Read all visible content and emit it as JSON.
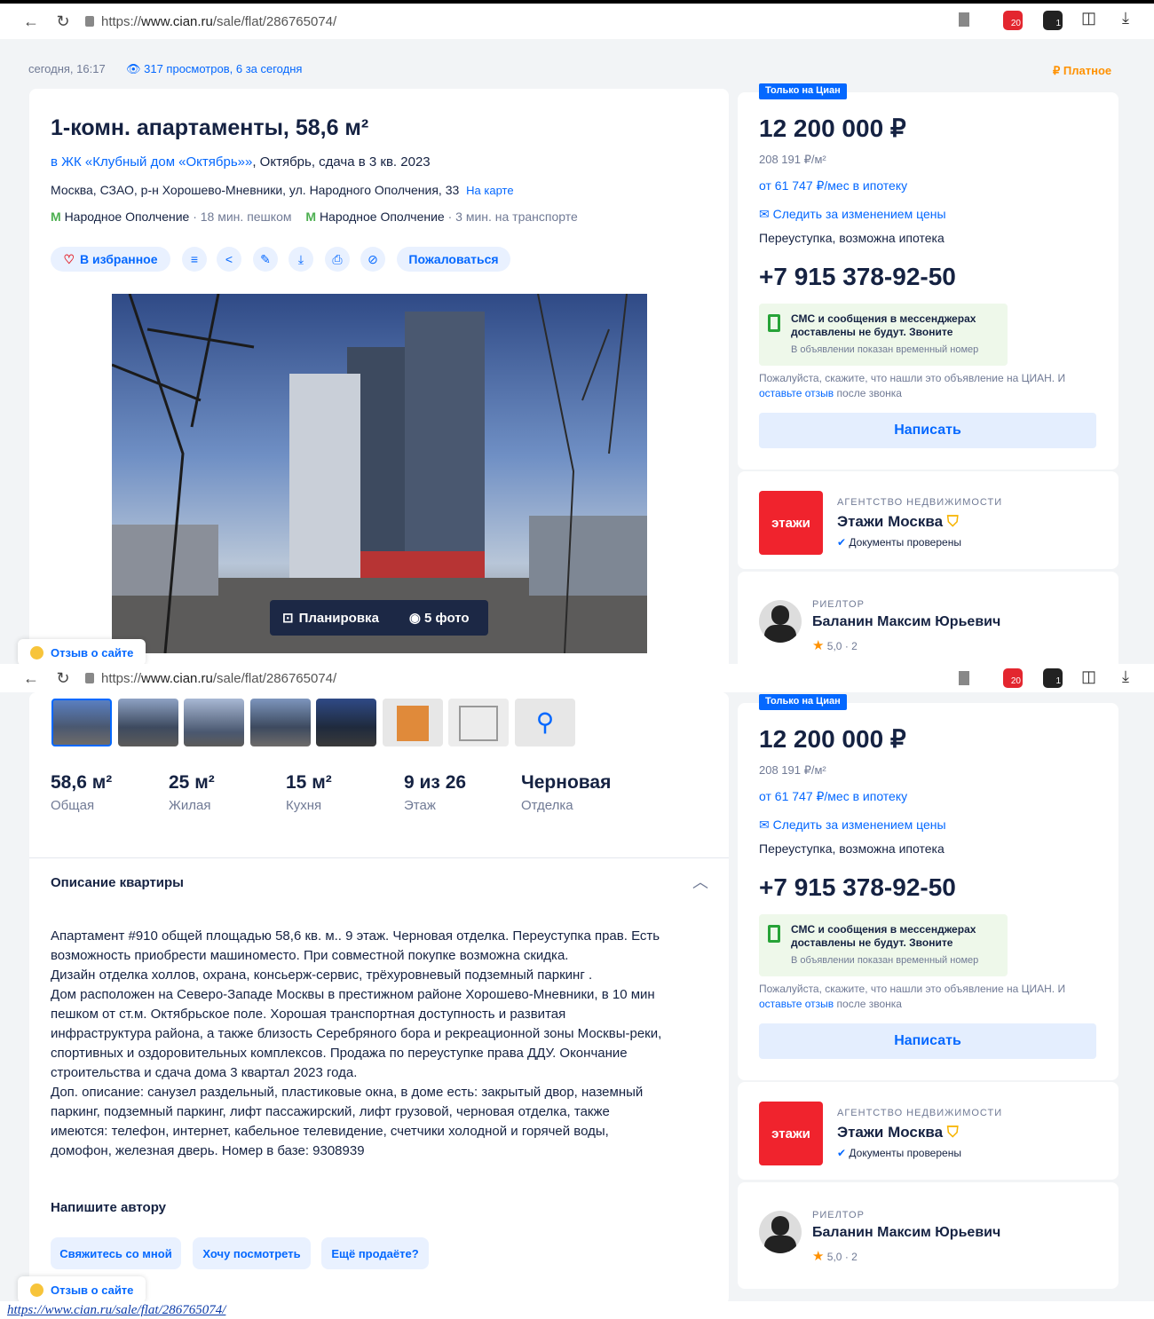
{
  "browser": {
    "url_prefix": "https://",
    "url_host": "www.cian.ru",
    "url_path": "/sale/flat/286765074/",
    "ext1_badge": "20",
    "ext2_badge": "1"
  },
  "meta": {
    "date": "сегодня, 16:17",
    "views": "317 просмотров, 6 за сегодня",
    "paid": "Платное"
  },
  "listing": {
    "title": "1-комн. апартаменты, 58,6 м²",
    "complex_link": "в ЖК «Клубный дом «Октябрь»»",
    "complex_rest": ", Октябрь, сдача в 3 кв. 2023",
    "address": "Москва, СЗАО, р-н Хорошево-Мневники, ул. Народного Ополчения, 33",
    "map_link": "На карте",
    "metro1_name": "Народное Ополчение",
    "metro1_time": "· 18 мин. пешком",
    "metro2_name": "Народное Ополчение",
    "metro2_time": "· 3 мин. на транспорте",
    "favorite": "В избранное",
    "complain": "Пожаловаться",
    "plan_btn": "Планировка",
    "photos_btn": "5 фото"
  },
  "stats": [
    {
      "value": "58,6 м²",
      "label": "Общая"
    },
    {
      "value": "25 м²",
      "label": "Жилая"
    },
    {
      "value": "15 м²",
      "label": "Кухня"
    },
    {
      "value": "9 из 26",
      "label": "Этаж"
    },
    {
      "value": "Черновая",
      "label": "Отделка"
    }
  ],
  "description": {
    "heading": "Описание квартиры",
    "text": "Апартамент #910 общей площадью 58,6 кв. м.. 9 этаж. Черновая отделка. Переуступка прав. Есть\nвозможность приобрести машиноместо. При совместной покупке возможна скидка.\nДизайн отделка холлов, охрана, консьерж-сервис, трёхуровневый подземный паркинг .\nДом расположен на Северо-Западе Москвы в престижном районе Хорошево-Мневники, в 10 мин\nпешком от ст.м. Октябрьское поле. Хорошая транспортная доступность и развитая\nинфраструктура района, а также близость Серебряного бора и рекреационной зоны Москвы-реки,\nспортивных и оздоровительных комплексов. Продажа по переуступке права ДДУ. Окончание\nстроительства и сдача дома 3 квартал 2023 года.\n Доп. описание: санузел раздельный, пластиковые окна, в доме есть: закрытый двор, наземный\nпаркинг, подземный паркинг, лифт пассажирский, лифт грузовой, черновая отделка, также\nимеются: телефон, интернет, кабельное телевидение, счетчики холодной и горячей воды,\nдомофон, железная дверь. Номер в базе: 9308939"
  },
  "contact_author": {
    "heading": "Напишите автору",
    "q1": "Свяжитесь со мной",
    "q2": "Хочу посмотреть",
    "q3": "Ещё продаёте?"
  },
  "sidebar": {
    "badge": "Только на Циан",
    "price": "12 200 000 ₽",
    "price_m2": "208 191 ₽/м²",
    "mortgage": "от 61 747 ₽/мес в ипотеку",
    "watch_price": "Следить за изменением цены",
    "sale_type": "Переуступка, возможна ипотека",
    "phone": "+7 915 378-92-50",
    "sms_line1": "СМС и сообщения в мессенджерах",
    "sms_line2": "доставлены не будут. Звоните",
    "sms_line3": "В объявлении показан временный номер",
    "please_text": "Пожалуйста, скажите, что нашли это объявление на ЦИАН. И",
    "review_link": "оставьте отзыв",
    "after_call": " после звонка",
    "write_btn": "Написать",
    "agency_label": "АГЕНТСТВО НЕДВИЖИМОСТИ",
    "agency_logo_text": "этажи",
    "agency_name": "Этажи Москва",
    "docs_checked": "Документы проверены",
    "realtor_label": "РИЕЛТОР",
    "realtor_name": "Баланин Максим Юрьевич",
    "rating": "5,0 · 2"
  },
  "feedback": "Отзыв о сайте",
  "footer_link": "https://www.cian.ru/sale/flat/286765074/",
  "colors": {
    "accent": "#0468ff",
    "brand_red": "#f0232d",
    "orange": "#ff9100",
    "text": "#152242"
  }
}
